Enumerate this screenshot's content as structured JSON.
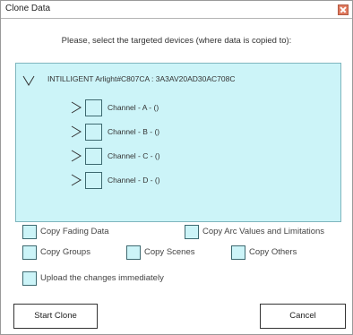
{
  "window": {
    "title": "Clone Data"
  },
  "instruction": "Please, select the targeted devices (where data is copied to):",
  "device": {
    "label": "INTILLIGENT Arlight#C807CA : 3A3AV20AD30AC708C",
    "channels": [
      {
        "label": "Channel - A - ()"
      },
      {
        "label": "Channel - B - ()"
      },
      {
        "label": "Channel - C - ()"
      },
      {
        "label": "Channel - D - ()"
      }
    ]
  },
  "options": {
    "copy_fading": "Copy Fading Data",
    "copy_arc": "Copy Arc Values and Limitations",
    "copy_groups": "Copy Groups",
    "copy_scenes": "Copy Scenes",
    "copy_others": "Copy Others",
    "upload_immediately": "Upload the changes immediately"
  },
  "buttons": {
    "start_clone": "Start Clone",
    "cancel": "Cancel"
  },
  "colors": {
    "panel_bg": "#ccf4f8",
    "close_button": "#e07a5f"
  }
}
